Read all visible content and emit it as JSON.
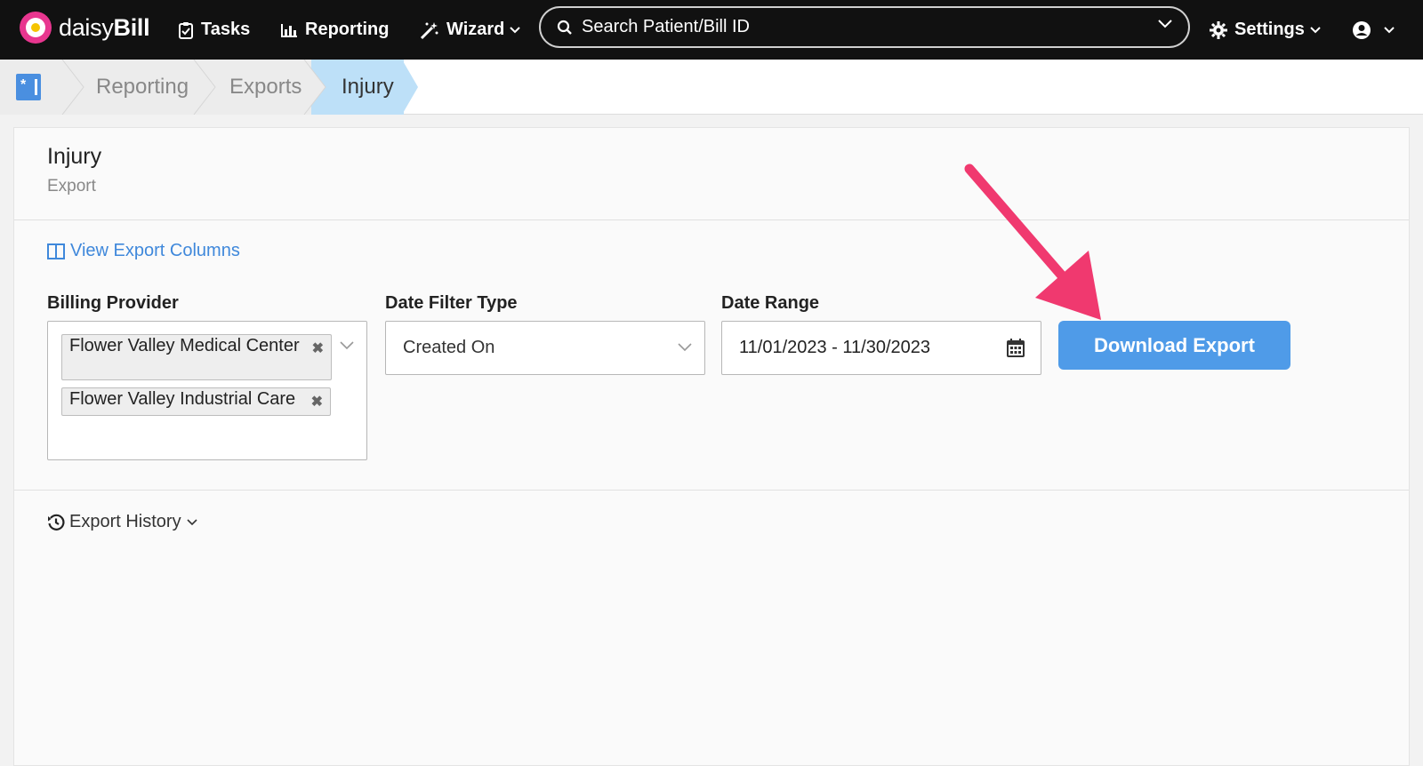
{
  "brand": {
    "name_light": "daisy",
    "name_bold": "Bill"
  },
  "nav": {
    "tasks": "Tasks",
    "reporting": "Reporting",
    "wizard": "Wizard",
    "settings": "Settings"
  },
  "search": {
    "placeholder": "Search Patient/Bill ID"
  },
  "breadcrumb": [
    "Reporting",
    "Exports",
    "Injury"
  ],
  "page": {
    "title": "Injury",
    "subtitle": "Export"
  },
  "links": {
    "view_columns": "View Export Columns",
    "export_history": "Export History"
  },
  "form": {
    "billing_provider": {
      "label": "Billing Provider",
      "selected": [
        "Flower Valley Medical Center",
        "Flower Valley Industrial Care"
      ]
    },
    "date_filter_type": {
      "label": "Date Filter Type",
      "value": "Created On"
    },
    "date_range": {
      "label": "Date Range",
      "value": "11/01/2023 - 11/30/2023"
    },
    "download_button": "Download Export"
  },
  "colors": {
    "accent": "#4f9be8",
    "link": "#3f88db",
    "brand": "#e8368f",
    "annotation_arrow": "#f0396f",
    "breadcrumb_active": "#bde0f8"
  }
}
